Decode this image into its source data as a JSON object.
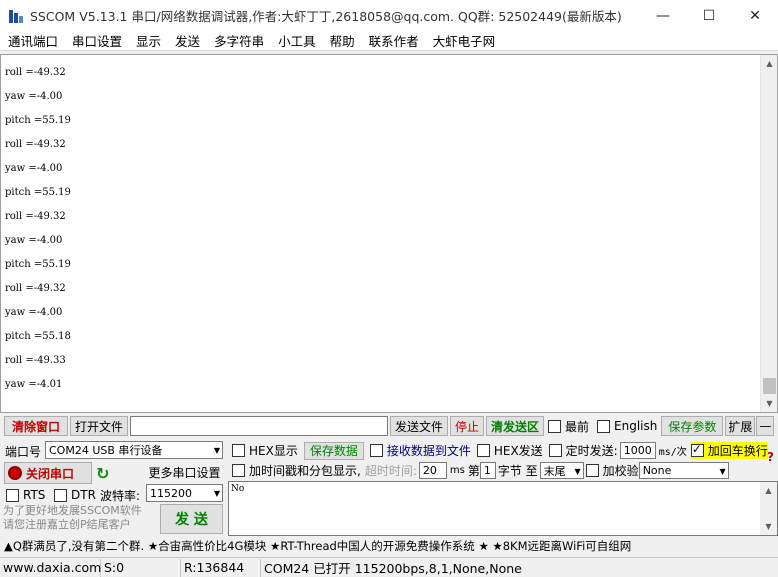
{
  "window": {
    "title": "SSCOM V5.13.1 串口/网络数据调试器,作者:大虾丁丁,2618058@qq.com. QQ群: 52502449(最新版本)",
    "minimize": "—",
    "maximize": "☐",
    "close": "✕"
  },
  "menu": [
    "通讯端口",
    "串口设置",
    "显示",
    "发送",
    "多字符串",
    "小工具",
    "帮助",
    "联系作者",
    "大虾电子网"
  ],
  "terminal": {
    "lines": [
      "roll =-49.32",
      "yaw =-4.00",
      "pitch =55.19",
      "roll =-49.32",
      "yaw =-4.00",
      "pitch =55.19",
      "roll =-49.32",
      "yaw =-4.00",
      "pitch =55.19",
      "roll =-49.32",
      "yaw =-4.00",
      "pitch =55.18",
      "roll =-49.33",
      "yaw =-4.01"
    ]
  },
  "toolbar": {
    "clear_window": "清除窗口",
    "open_file": "打开文件",
    "file_path": "",
    "send_file": "发送文件",
    "stop": "停止",
    "send_area": "清发送区",
    "front": "最前",
    "english": "English",
    "save_params": "保存参数",
    "expand": "扩展",
    "collapse": "—"
  },
  "port": {
    "port_label": "端口号",
    "port_value": "COM24 USB 串行设备",
    "close_port": "关闭串口",
    "more_settings": "更多串口设置",
    "rts": "RTS",
    "dtr": "DTR",
    "baud_label": "波特率:",
    "baud_value": "115200",
    "promo": "为了更好地发展SSCOM软件\n请您注册嘉立创P结尾客户",
    "send": "发 送"
  },
  "options": {
    "hex_display": "HEX显示",
    "save_data": "保存数据",
    "recv_to_file": "接收数据到文件",
    "hex_send": "HEX发送",
    "timed_send": "定时发送:",
    "interval": "1000",
    "interval_unit": "ms/次",
    "add_crlf": "加回车换行",
    "timestamp": "加时间戳和分包显示,",
    "timeout_label": "超时时间:",
    "timeout_value": "20",
    "timeout_unit": "ms",
    "nth_label": "第",
    "nth_value": "1",
    "byte_label": "字节 至",
    "end_value": "末尾",
    "checksum_label": "加校验",
    "checksum_value": "None",
    "help": "?"
  },
  "send_box": {
    "text": "No"
  },
  "ad": "▲Q群满员了,没有第二个群. ★合宙高性价比4G模块 ★RT-Thread中国人的开源免费操作系统 ★ ★8KM远距离WiFi可自组网",
  "status": {
    "website": "www.daxia.com",
    "sent": "S:0",
    "received": "R:136844",
    "port_state": "COM24 已打开  115200bps,8,1,None,None"
  }
}
